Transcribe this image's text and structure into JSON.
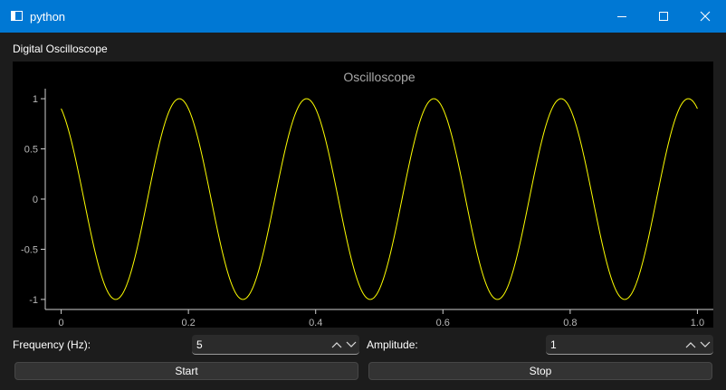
{
  "window": {
    "title": "python"
  },
  "group": {
    "title": "Digital Oscilloscope"
  },
  "chart_data": {
    "type": "line",
    "title": "Oscilloscope",
    "xlabel": "",
    "ylabel": "",
    "xlim": [
      -0.025,
      1.025
    ],
    "ylim": [
      -1.1,
      1.1
    ],
    "xticks": [
      0,
      0.2,
      0.4,
      0.6,
      0.8,
      1.0
    ],
    "xtick_labels": [
      "0",
      "0.2",
      "0.4",
      "0.6",
      "0.8",
      "1.0"
    ],
    "yticks": [
      1,
      0.5,
      0,
      -0.5,
      -1
    ],
    "ytick_labels": [
      "1",
      "0.5",
      "0",
      "-0.5",
      "-1"
    ],
    "grid": false,
    "series": [
      {
        "function": "cos",
        "frequency": 5,
        "amplitude": 1,
        "phase": 0.45,
        "x_range": [
          0,
          1
        ],
        "color": "#ffff00"
      }
    ]
  },
  "controls": {
    "frequency_label": "Frequency (Hz):",
    "frequency_value": "5",
    "amplitude_label": "Amplitude:",
    "amplitude_value": "1",
    "start_label": "Start",
    "stop_label": "Stop"
  },
  "colors": {
    "titlebar": "#0078d4",
    "background": "#1c1c1c",
    "plot_background": "#000000",
    "trace": "#ffff00",
    "axis": "#cfcfcf"
  },
  "icons": {
    "minimize": "minimize-icon",
    "maximize": "maximize-icon",
    "close": "close-icon",
    "up": "chevron-up-icon",
    "down": "chevron-down-icon"
  }
}
